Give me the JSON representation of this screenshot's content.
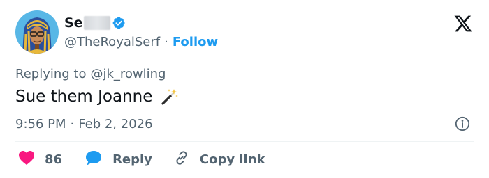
{
  "author": {
    "display_name": "Se",
    "handle": "@TheRoyalSerf",
    "separator": "·",
    "follow_label": "Follow",
    "verified_color": "#1d9bf0"
  },
  "reply_context": {
    "prefix": "Replying to",
    "handle": "@jk_rowling"
  },
  "tweet": {
    "text": "Sue them Joanne",
    "emoji": "magic-wand"
  },
  "timestamp": {
    "time": "9:56 PM",
    "separator": "·",
    "date": "Feb 2, 2026"
  },
  "actions": {
    "like_count": "86",
    "reply_label": "Reply",
    "copy_label": "Copy link"
  },
  "colors": {
    "like": "#f91880",
    "reply": "#1d9bf0",
    "link": "#1d9bf0",
    "muted": "#536471",
    "text": "#0f1419"
  }
}
